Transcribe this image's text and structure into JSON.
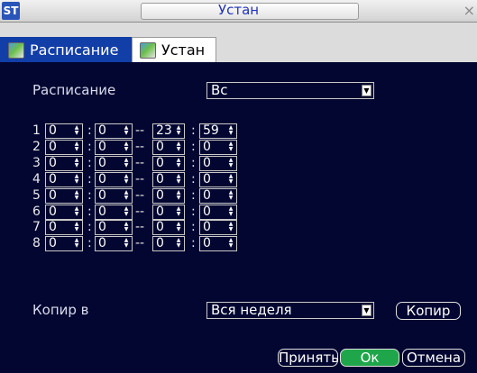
{
  "window": {
    "title": "Устан",
    "logo": "ST",
    "close": "×"
  },
  "tabs": [
    {
      "label": "Расписание",
      "active": true
    },
    {
      "label": "Устан",
      "active": false
    }
  ],
  "schedule": {
    "label": "Расписание",
    "day": "Вс"
  },
  "periods": [
    {
      "n": "1",
      "v": [
        "0",
        "0",
        "23",
        "59"
      ]
    },
    {
      "n": "2",
      "v": [
        "0",
        "0",
        "0",
        "0"
      ]
    },
    {
      "n": "3",
      "v": [
        "0",
        "0",
        "0",
        "0"
      ]
    },
    {
      "n": "4",
      "v": [
        "0",
        "0",
        "0",
        "0"
      ]
    },
    {
      "n": "5",
      "v": [
        "0",
        "0",
        "0",
        "0"
      ]
    },
    {
      "n": "6",
      "v": [
        "0",
        "0",
        "0",
        "0"
      ]
    },
    {
      "n": "7",
      "v": [
        "0",
        "0",
        "0",
        "0"
      ]
    },
    {
      "n": "8",
      "v": [
        "0",
        "0",
        "0",
        "0"
      ]
    }
  ],
  "copy": {
    "label": "Копир в",
    "target": "Вся неделя",
    "button": "Копир"
  },
  "footer": {
    "apply": "Принять",
    "ok": "Ок",
    "cancel": "Отмена"
  },
  "icons": {
    "tab": "picture-icon",
    "dropdown": "chevron-down-icon",
    "spinner": "up-down-arrows-icon"
  },
  "colors": {
    "content_bg": "#020630",
    "active_tab": "#123ea8",
    "ok_button": "#1fa64a",
    "title_text": "#2233bb"
  }
}
